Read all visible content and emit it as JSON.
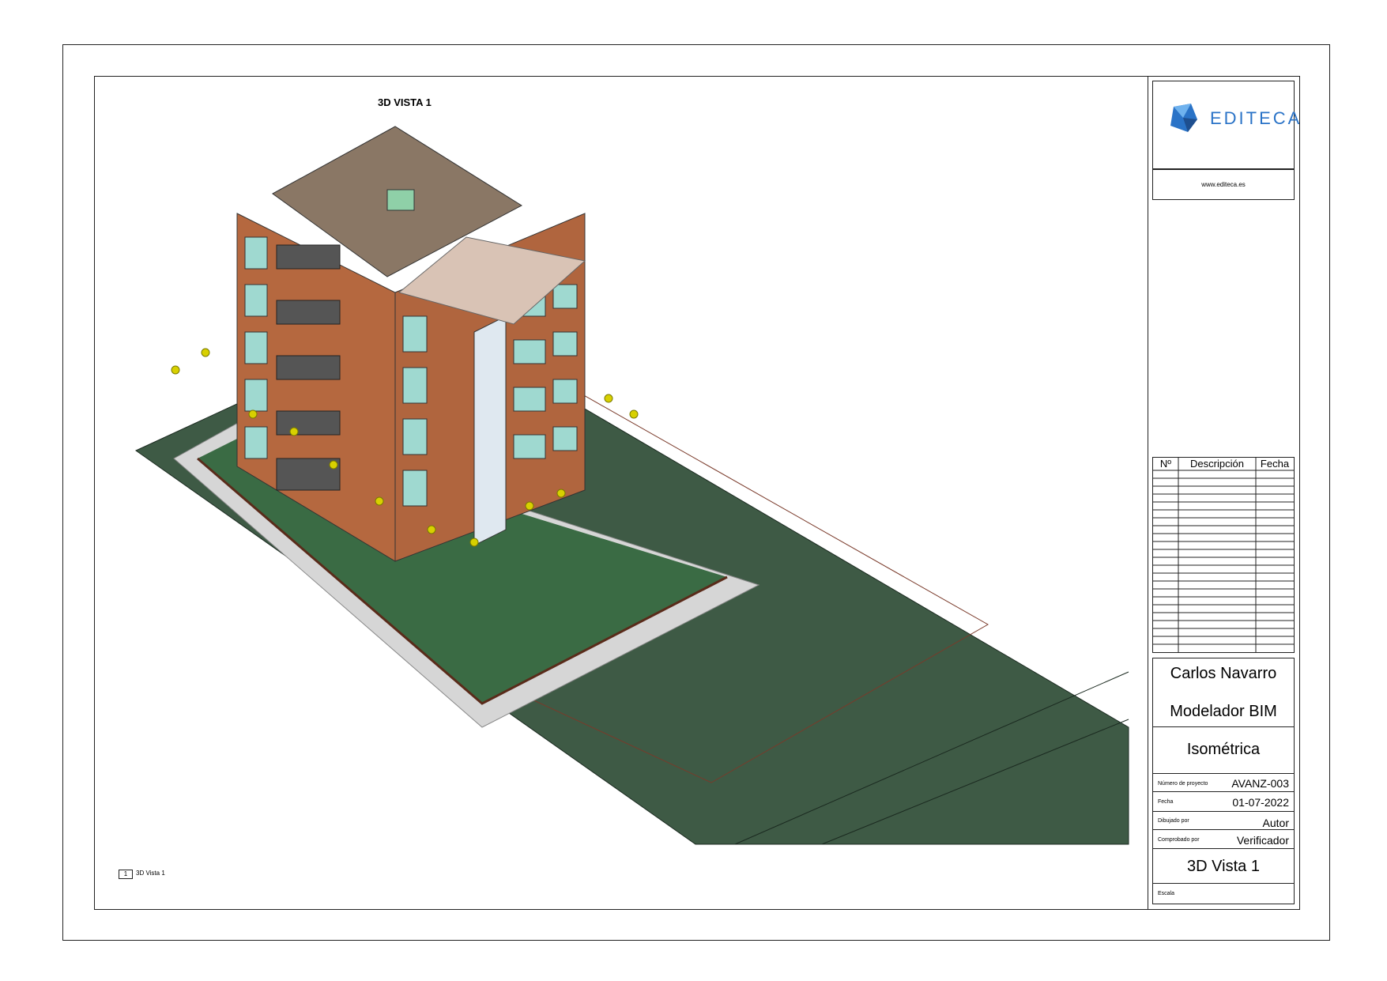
{
  "view_title": "3D VISTA 1",
  "title_block": {
    "logo_text": "EDITECA",
    "website": "www.editeca.es",
    "revision_headers": {
      "no": "Nº",
      "description": "Descripción",
      "date": "Fecha"
    },
    "author_name": "Carlos Navarro",
    "author_role": "Modelador BIM",
    "drawing_type": "Isométrica",
    "project_number_label": "Número de proyecto",
    "project_number": "AVANZ-003",
    "date_label": "Fecha",
    "date": "01-07-2022",
    "drawn_by_label": "Dibujado por",
    "drawn_by": "Autor",
    "checked_by_label": "Comprobado por",
    "checked_by": "Verificador",
    "view_name": "3D Vista 1",
    "scale_label": "Escala"
  },
  "viewport_tag": {
    "number": "1",
    "name": "3D Vista 1"
  },
  "colors": {
    "terrain": "#3e5a45",
    "brick": "#b5683f",
    "roof": "#8a7765",
    "glass": "#9fd9d0",
    "pavement": "#cfcfcf",
    "logo_blue": "#2a73c7"
  }
}
